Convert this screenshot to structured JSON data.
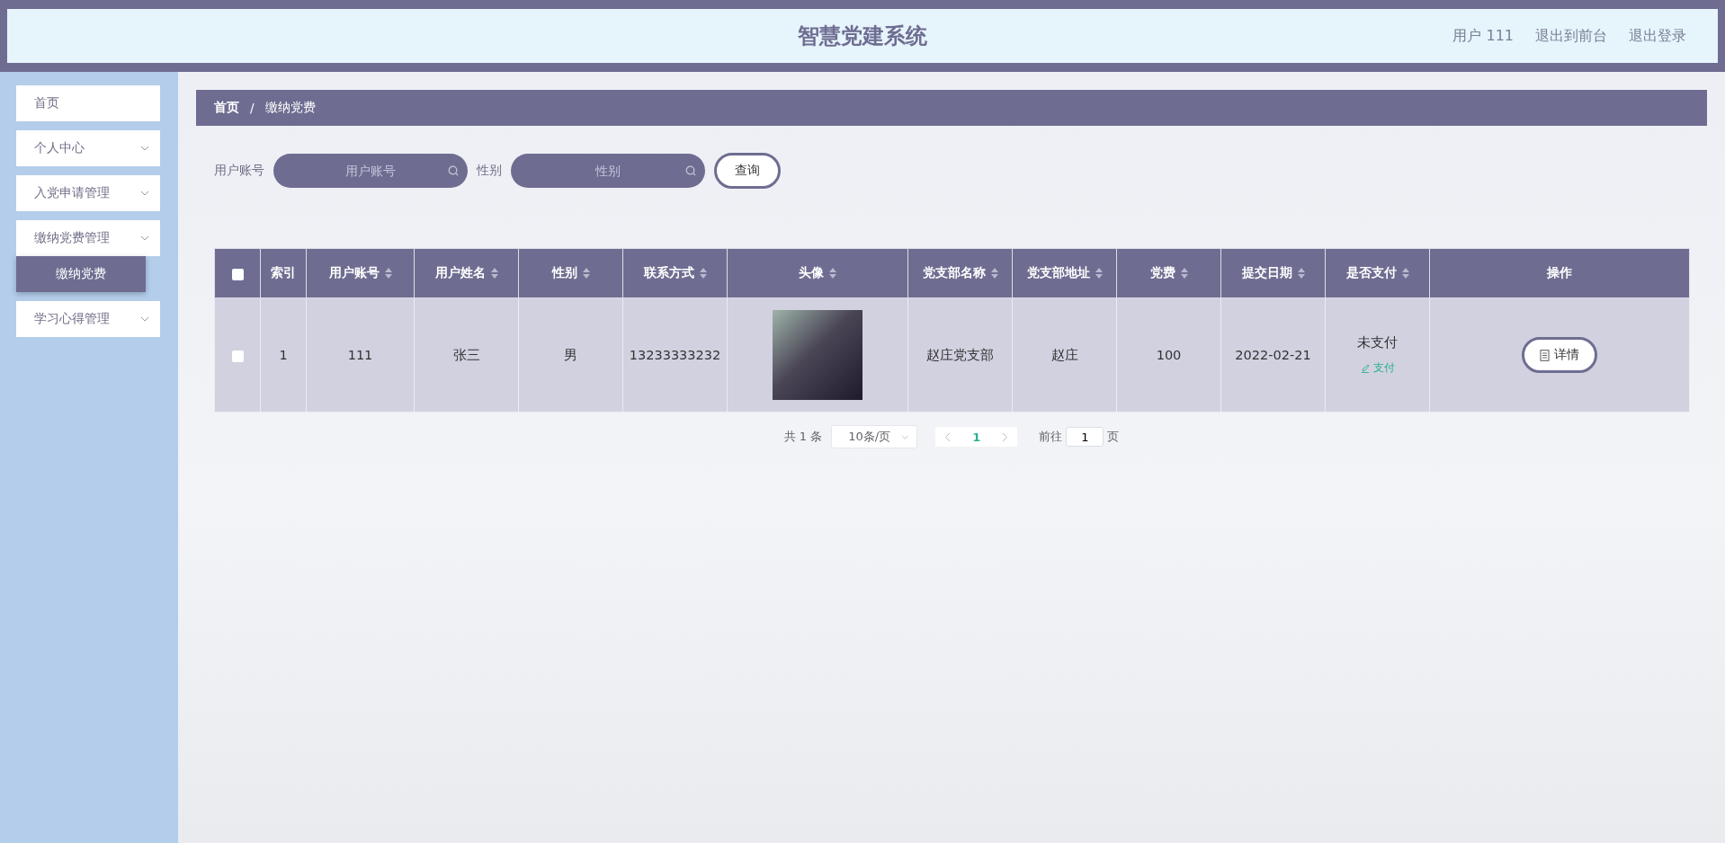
{
  "header": {
    "title": "智慧党建系统",
    "links": [
      "用户 111",
      "退出到前台",
      "退出登录"
    ]
  },
  "sidebar": {
    "items": [
      {
        "label": "首页",
        "has_children": false
      },
      {
        "label": "个人中心",
        "has_children": true
      },
      {
        "label": "入党申请管理",
        "has_children": true
      },
      {
        "label": "缴纳党费管理",
        "has_children": true,
        "expanded": true,
        "children": [
          {
            "label": "缴纳党费",
            "selected": true
          }
        ]
      },
      {
        "label": "学习心得管理",
        "has_children": true
      }
    ]
  },
  "breadcrumb": [
    "首页",
    "/",
    "缴纳党费"
  ],
  "search": {
    "fields": [
      {
        "label": "用户账号",
        "placeholder": "用户账号"
      },
      {
        "label": "性别",
        "placeholder": "性别"
      }
    ],
    "button": "查询"
  },
  "table": {
    "select_all_checked": false,
    "columns": [
      {
        "label": "索引",
        "sortable": false
      },
      {
        "label": "用户账号",
        "sortable": true
      },
      {
        "label": "用户姓名",
        "sortable": true
      },
      {
        "label": "性别",
        "sortable": true
      },
      {
        "label": "联系方式",
        "sortable": true
      },
      {
        "label": "头像",
        "sortable": true
      },
      {
        "label": "党支部名称",
        "sortable": true
      },
      {
        "label": "党支部地址",
        "sortable": true
      },
      {
        "label": "党费",
        "sortable": true
      },
      {
        "label": "提交日期",
        "sortable": true
      },
      {
        "label": "是否支付",
        "sortable": true
      },
      {
        "label": "操作",
        "sortable": false
      }
    ],
    "rows": [
      {
        "checked": false,
        "cells": [
          "1",
          "111",
          "张三",
          "男",
          "13233333232"
        ],
        "cells_after": [
          "赵庄党支部",
          "赵庄",
          "100",
          "2022-02-21"
        ],
        "pay_status": "未支付",
        "pay_action": "支付",
        "detail_button": "详情"
      }
    ]
  },
  "pagination": {
    "total": "共 1 条",
    "page_size": "10条/页",
    "pages": [
      {
        "label": "1",
        "selected": true
      }
    ],
    "goto_label": "前往",
    "goto_value": "1",
    "goto_suffix": "页"
  }
}
